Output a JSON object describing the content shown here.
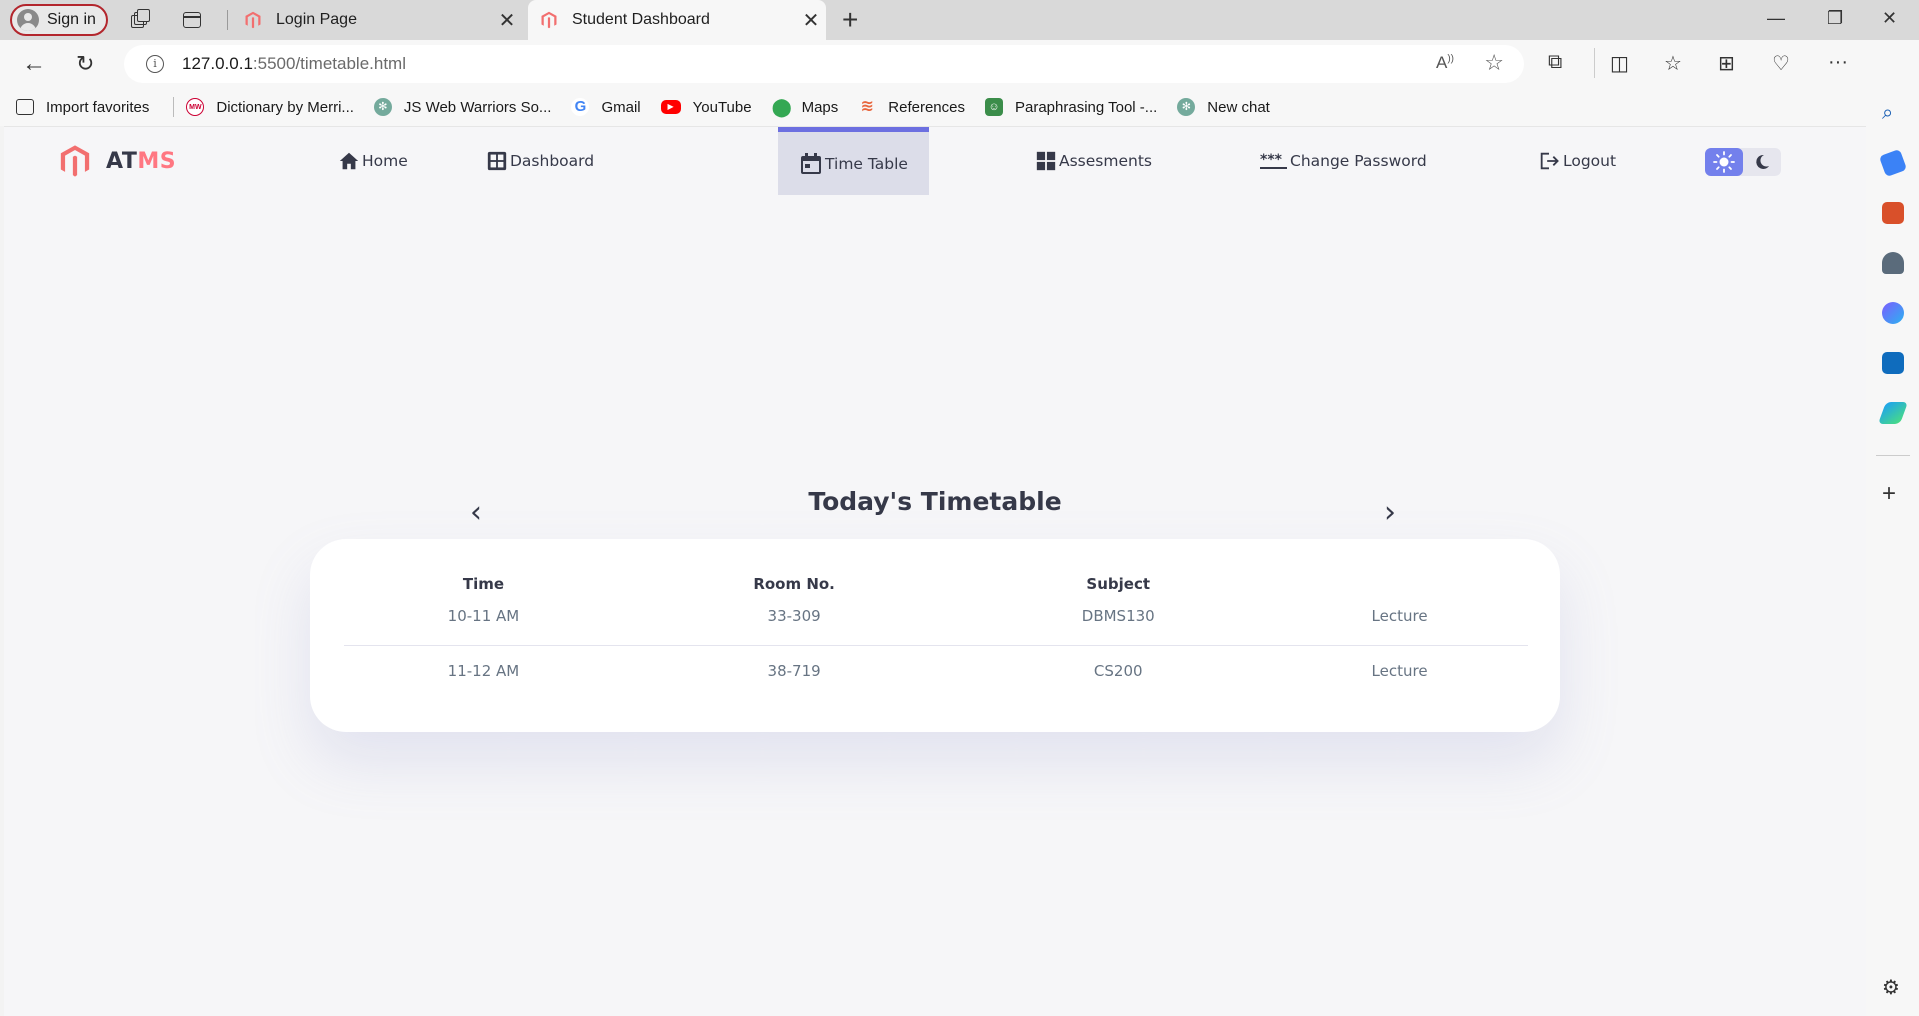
{
  "browser": {
    "signin_label": "Sign in",
    "tabs": [
      {
        "title": "Login Page"
      },
      {
        "title": "Student Dashboard"
      }
    ],
    "url_host": "127.0.0.1",
    "url_path": ":5500/timetable.html",
    "bookmarks": [
      {
        "label": "Import favorites",
        "icon": "import-icon"
      },
      {
        "label": "Dictionary by Merri...",
        "icon": "merriam-webster-icon"
      },
      {
        "label": "JS Web Warriors So...",
        "icon": "chatgpt-icon"
      },
      {
        "label": "Gmail",
        "icon": "google-icon"
      },
      {
        "label": "YouTube",
        "icon": "youtube-icon"
      },
      {
        "label": "Maps",
        "icon": "maps-icon"
      },
      {
        "label": "References",
        "icon": "references-icon"
      },
      {
        "label": "Paraphrasing Tool -...",
        "icon": "paraphrasing-icon"
      },
      {
        "label": "New chat",
        "icon": "chatgpt-icon"
      }
    ]
  },
  "app": {
    "brand_a": "AT",
    "brand_b": "MS",
    "nav": [
      {
        "label": "Home",
        "icon": "home-icon"
      },
      {
        "label": "Dashboard",
        "icon": "dashboard-icon"
      },
      {
        "label": "Time Table",
        "icon": "calendar-icon",
        "active": true
      },
      {
        "label": "Assesments",
        "icon": "grid-icon"
      },
      {
        "label": "Change Password",
        "icon": "password-icon"
      },
      {
        "label": "Logout",
        "icon": "logout-icon"
      }
    ],
    "theme": {
      "light": "sun-icon",
      "dark": "moon-icon",
      "selected": "light"
    },
    "colors": {
      "primary": "#7380ec",
      "brand_accent": "#ff7782",
      "dark_text": "#363949"
    }
  },
  "timetable": {
    "title": "Today's Timetable",
    "headers": [
      "Time",
      "Room No.",
      "Subject",
      ""
    ],
    "rows": [
      [
        "10-11 AM",
        "33-309",
        "DBMS130",
        "Lecture"
      ],
      [
        "11-12 AM",
        "38-719",
        "CS200",
        "Lecture"
      ]
    ]
  }
}
